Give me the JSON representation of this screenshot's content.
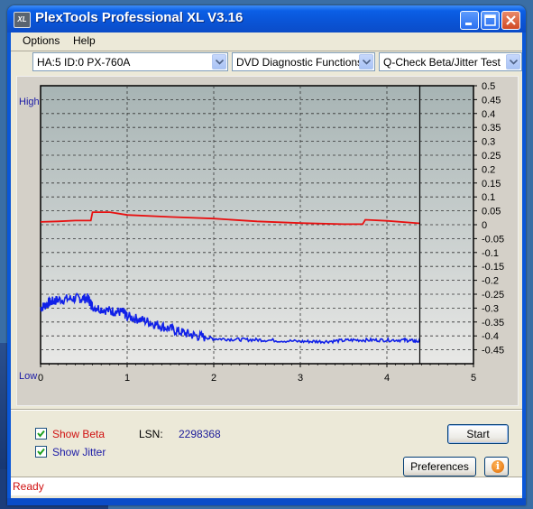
{
  "window": {
    "title": "PlexTools Professional XL V3.16",
    "icon_text": "XL"
  },
  "menu": {
    "options": "Options",
    "help": "Help"
  },
  "toolbar": {
    "drive": "HA:5 ID:0  PX-760A",
    "function": "DVD Diagnostic Functions",
    "test": "Q-Check Beta/Jitter Test"
  },
  "chart_labels": {
    "high": "High",
    "low": "Low"
  },
  "chart_data": {
    "type": "line",
    "x_ticks": [
      0,
      1,
      2,
      3,
      4,
      5
    ],
    "xlim": [
      0,
      5
    ],
    "y_right_ticks": [
      "0.5",
      "0.45",
      "0.4",
      "0.35",
      "0.3",
      "0.25",
      "0.2",
      "0.15",
      "0.1",
      "0.05",
      "0",
      "-0.05",
      "-0.1",
      "-0.15",
      "-0.2",
      "-0.25",
      "-0.3",
      "-0.35",
      "-0.4",
      "-0.45"
    ],
    "ylim": [
      -0.5,
      0.5
    ],
    "grid": true,
    "cursor_x": 4.38,
    "series": [
      {
        "name": "Beta",
        "color": "#e81010",
        "x": [
          0,
          0.2,
          0.4,
          0.58,
          0.6,
          0.8,
          1.0,
          1.5,
          2.0,
          2.5,
          3.0,
          3.5,
          3.72,
          3.75,
          4.0,
          4.38
        ],
        "y": [
          0.01,
          0.012,
          0.015,
          0.015,
          0.045,
          0.045,
          0.035,
          0.028,
          0.022,
          0.012,
          0.006,
          0.002,
          0.002,
          0.018,
          0.014,
          0.005
        ]
      },
      {
        "name": "Jitter",
        "color": "#1020e8",
        "x": [
          0,
          0.1,
          0.2,
          0.4,
          0.55,
          0.6,
          0.8,
          0.95,
          1.0,
          1.2,
          1.4,
          1.6,
          1.8,
          2.0,
          2.3,
          2.6,
          3.0,
          3.3,
          3.6,
          3.9,
          4.2,
          4.38
        ],
        "y": [
          -0.3,
          -0.28,
          -0.27,
          -0.265,
          -0.265,
          -0.295,
          -0.31,
          -0.315,
          -0.33,
          -0.345,
          -0.365,
          -0.385,
          -0.4,
          -0.41,
          -0.413,
          -0.415,
          -0.42,
          -0.42,
          -0.415,
          -0.415,
          -0.415,
          -0.42
        ]
      }
    ]
  },
  "controls": {
    "show_beta": "Show Beta",
    "show_jitter": "Show Jitter",
    "show_beta_checked": true,
    "show_jitter_checked": true,
    "lsn_label": "LSN:",
    "lsn_value": "2298368",
    "start": "Start",
    "preferences": "Preferences"
  },
  "status": {
    "text": "Ready"
  },
  "colors": {
    "plot_bg_top": "#a7b4b4",
    "plot_bg_bottom": "#e8e8e6",
    "beta": "#e81010",
    "jitter": "#1020e8"
  }
}
